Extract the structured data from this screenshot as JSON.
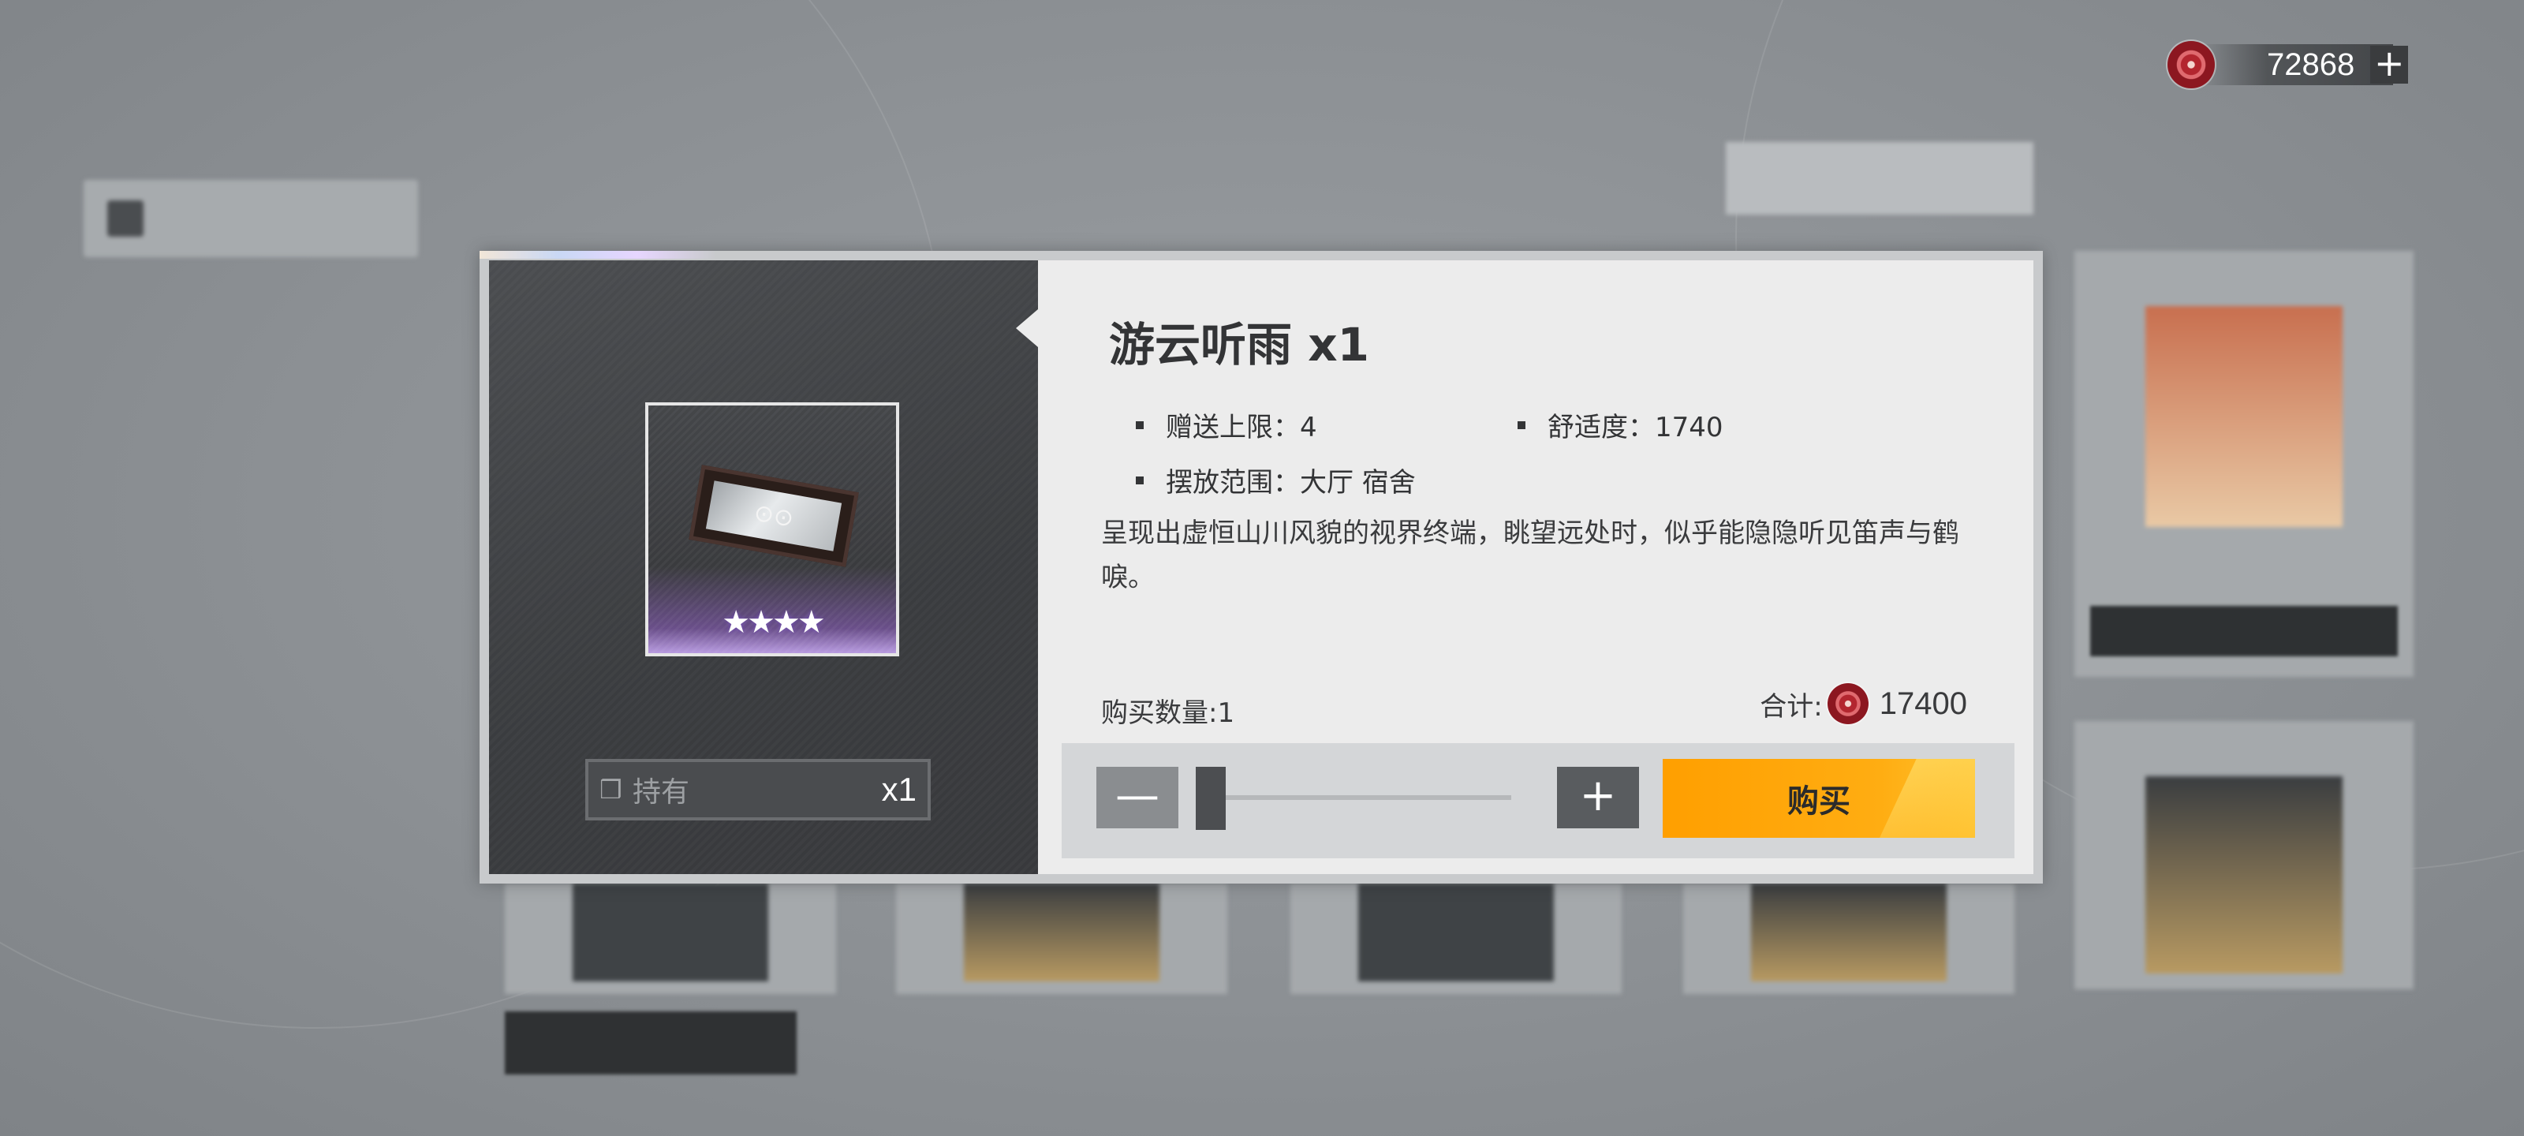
{
  "currency": {
    "icon": "coin-icon",
    "amount": "72868",
    "add_icon": "plus-icon"
  },
  "item": {
    "title": "游云听雨 x1",
    "stars": "★★★★",
    "own_label": "持有",
    "own_count": "x1",
    "attrs": {
      "gift_limit": "赠送上限：4",
      "comfort": "舒适度：1740",
      "placement": "摆放范围：大厅 宿舍"
    },
    "description": "呈现出虚恒山川风貌的视界终端，眺望远处时，似乎能隐隐听见笛声与鹤唳。"
  },
  "purchase": {
    "quantity_label": "购买数量:1",
    "total_label": "合计:",
    "total_amount": "17400",
    "quantity": 1,
    "quantity_max": 4,
    "minus_symbol": "—",
    "plus_symbol": "+",
    "buy_label": "购买"
  },
  "colors": {
    "accent": "#ffa400",
    "panel": "#ececec",
    "dark_panel": "#3f4144"
  }
}
